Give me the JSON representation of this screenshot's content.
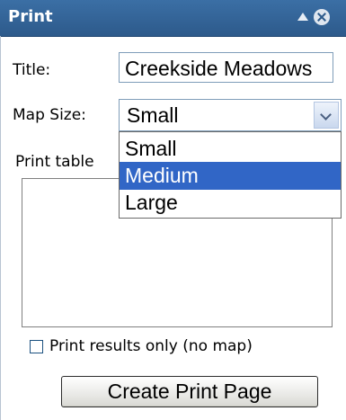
{
  "panel": {
    "title": "Print",
    "collapse_icon": "triangle-up-icon",
    "close_icon": "close-circle-icon"
  },
  "form": {
    "title_label": "Title:",
    "title_value": "Creekside Meadows",
    "map_size_label": "Map Size:",
    "map_size_selected": "Small",
    "map_size_options": [
      "Small",
      "Medium",
      "Large"
    ],
    "map_size_highlighted": "Medium",
    "print_table_label": "Print table",
    "print_results_only_label": "Print results only (no map)",
    "print_results_only_checked": false,
    "create_button_label": "Create Print Page"
  },
  "colors": {
    "titlebar": "#2d5a8b",
    "highlight": "#3166c6"
  }
}
